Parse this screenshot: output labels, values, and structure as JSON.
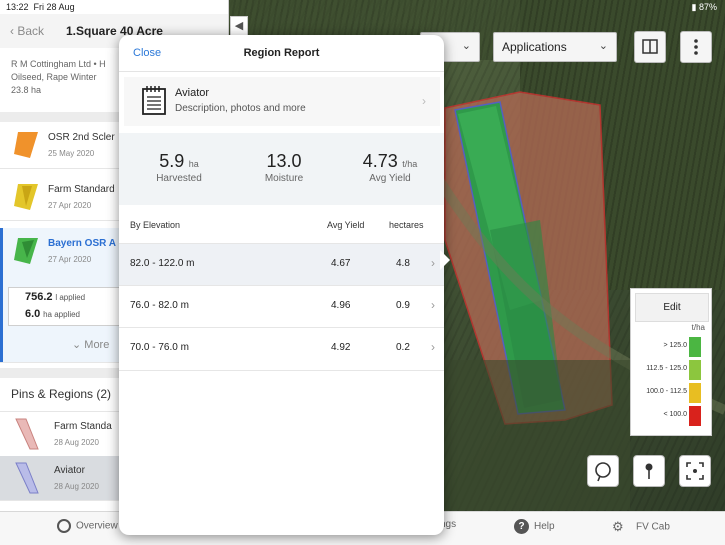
{
  "status_bar": {
    "time": "13:22",
    "date": "Fri 28 Aug",
    "battery": "87%"
  },
  "sidebar": {
    "back_label": "Back",
    "title": "1.Square 40 Acre",
    "info_lines": [
      "R M Cottingham Ltd • H",
      "Oilseed, Rape Winter",
      "23.8 ha"
    ],
    "applications": [
      {
        "name": "OSR 2nd Scler",
        "date": "25 May 2020",
        "color": "#f0922b"
      },
      {
        "name": "Farm Standard",
        "date": "27 Apr 2020",
        "color": "#e3c62a"
      },
      {
        "name": "Bayern OSR A",
        "date": "27 Apr 2020",
        "color": "#47b54a"
      }
    ],
    "applied": {
      "value1": "756.2",
      "unit1": "l applied",
      "value2": "6.0",
      "unit2": "ha applied"
    },
    "more_label": "More",
    "pins_title": "Pins & Regions (2)",
    "pins": [
      {
        "name": "Farm Standa",
        "date": "28 Aug 2020"
      },
      {
        "name": "Aviator",
        "date": "28 Aug 2020"
      }
    ]
  },
  "tabbar": {
    "overview": "Overview",
    "settings": "ngs",
    "help": "Help",
    "fv_cab": "FV Cab"
  },
  "toolbar": {
    "select1": "...",
    "applications": "Applications"
  },
  "legend": {
    "edit": "Edit",
    "unit": "t/ha",
    "rows": [
      {
        "label": "> 125.0",
        "color": "#4bb642"
      },
      {
        "label": "112.5 - 125.0",
        "color": "#8cc63e"
      },
      {
        "label": "100.0 - 112.5",
        "color": "#e8be22"
      },
      {
        "label": "< 100.0",
        "color": "#d9221c"
      }
    ]
  },
  "popover": {
    "close": "Close",
    "title": "Region Report",
    "aviator_name": "Aviator",
    "aviator_desc": "Description, photos and more",
    "stats": [
      {
        "value": "5.9",
        "unit": "ha",
        "label": "Harvested"
      },
      {
        "value": "13.0",
        "unit": "",
        "label": "Moisture"
      },
      {
        "value": "4.73",
        "unit": "t/ha",
        "label": "Avg Yield"
      }
    ],
    "table_headers": {
      "elevation": "By Elevation",
      "avg_yield": "Avg Yield",
      "hectares": "hectares"
    },
    "rows": [
      {
        "range": "82.0 - 122.0 m",
        "yield": "4.67",
        "hectares": "4.8"
      },
      {
        "range": "76.0 - 82.0 m",
        "yield": "4.96",
        "hectares": "0.9"
      },
      {
        "range": "70.0 - 76.0 m",
        "yield": "4.92",
        "hectares": "0.2"
      }
    ]
  }
}
